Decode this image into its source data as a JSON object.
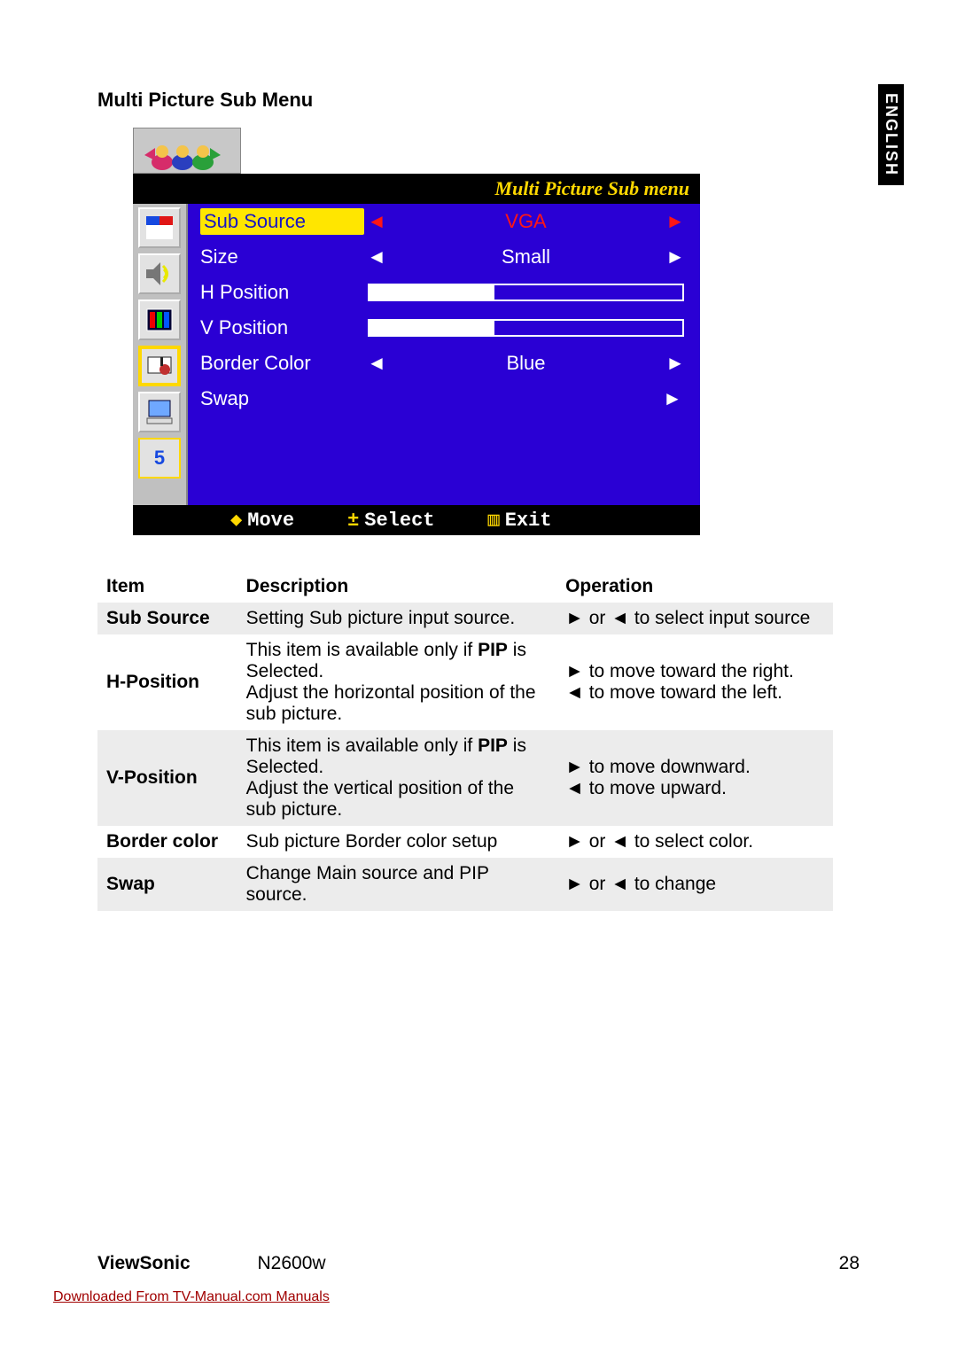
{
  "language_tab": "ENGLISH",
  "section_title": "Multi Picture Sub Menu",
  "osd": {
    "title": "Multi Picture Sub menu",
    "rows": [
      {
        "label": "Sub Source",
        "value": "VGA",
        "type": "select",
        "highlight": true
      },
      {
        "label": "Size",
        "value": "Small",
        "type": "select_white"
      },
      {
        "label": "H Position",
        "value": "",
        "type": "bar"
      },
      {
        "label": "V Position",
        "value": "",
        "type": "bar"
      },
      {
        "label": "Border Color",
        "value": "Blue",
        "type": "select_white"
      },
      {
        "label": "Swap",
        "value": "",
        "type": "action"
      }
    ],
    "footer": {
      "move": "Move",
      "select": "Select",
      "exit": "Exit"
    },
    "sidebar_icons": [
      "picture-icon",
      "audio-icon",
      "color-bars-icon",
      "setup-icon",
      "pc-icon",
      "channel-5-icon"
    ]
  },
  "table": {
    "headers": {
      "item": "Item",
      "description": "Description",
      "operation": "Operation"
    },
    "rows": [
      {
        "item": "Sub Source",
        "desc": "Setting Sub picture input source.",
        "op": "► or ◄ to select input source"
      },
      {
        "item": "H-Position",
        "desc_line1": "This item is available only if ",
        "desc_bold": "PIP",
        "desc_line2": " is Selected.",
        "desc_line3": "Adjust the horizontal position of the sub picture.",
        "op_line1": "► to move toward the right.",
        "op_line2": "◄ to move toward the left."
      },
      {
        "item": "V-Position",
        "desc_line1": "This item is available only if ",
        "desc_bold": "PIP",
        "desc_line2": " is Selected.",
        "desc_line3": "Adjust the vertical position of the sub picture.",
        "op_line1": "► to move downward.",
        "op_line2": "◄ to move upward."
      },
      {
        "item": "Border color",
        "desc": "Sub picture Border color setup",
        "op": "► or ◄ to select color."
      },
      {
        "item": "Swap",
        "desc": "Change Main source and PIP source.",
        "op": "► or ◄ to change"
      }
    ]
  },
  "footer": {
    "brand": "ViewSonic",
    "model": "N2600w",
    "page": "28"
  },
  "download_note": "Downloaded From TV-Manual.com Manuals"
}
